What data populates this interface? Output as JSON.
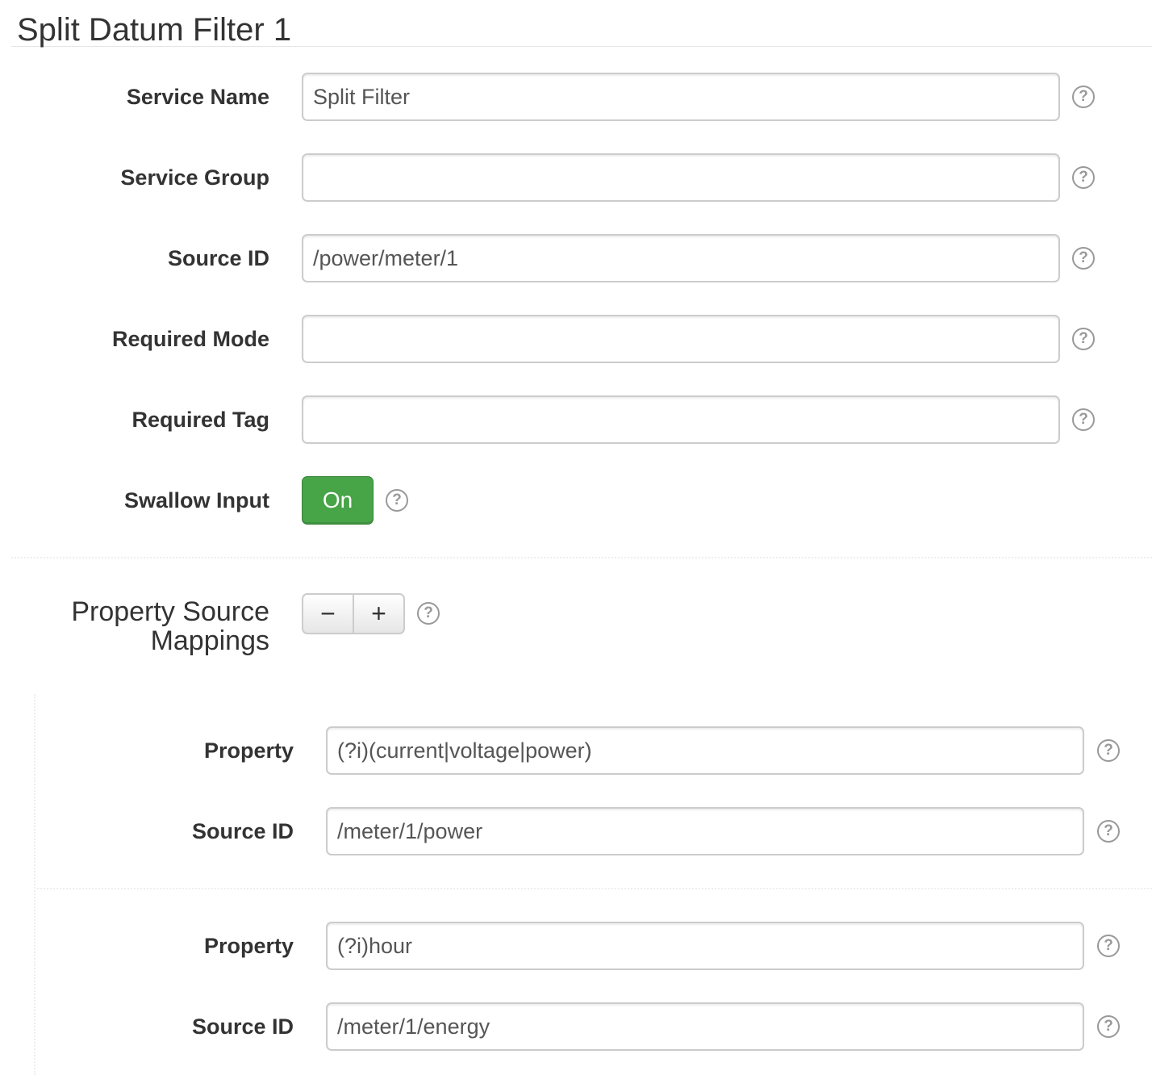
{
  "title": "Split Datum Filter 1",
  "fields": [
    {
      "label": "Service Name",
      "value": "Split Filter"
    },
    {
      "label": "Service Group",
      "value": ""
    },
    {
      "label": "Source ID",
      "value": "/power/meter/1"
    },
    {
      "label": "Required Mode",
      "value": ""
    },
    {
      "label": "Required Tag",
      "value": ""
    }
  ],
  "swallow_input": {
    "label": "Swallow Input",
    "toggle_label": "On",
    "state": true,
    "color": "#47a447"
  },
  "property_source_mappings": {
    "label_line1": "Property Source",
    "label_line2": "Mappings",
    "remove_label": "−",
    "add_label": "+",
    "items": [
      {
        "property_label": "Property",
        "property_value": "(?i)(current|voltage|power)",
        "source_label": "Source ID",
        "source_value": "/meter/1/power"
      },
      {
        "property_label": "Property",
        "property_value": "(?i)hour",
        "source_label": "Source ID",
        "source_value": "/meter/1/energy"
      }
    ]
  },
  "help_glyph": "?"
}
